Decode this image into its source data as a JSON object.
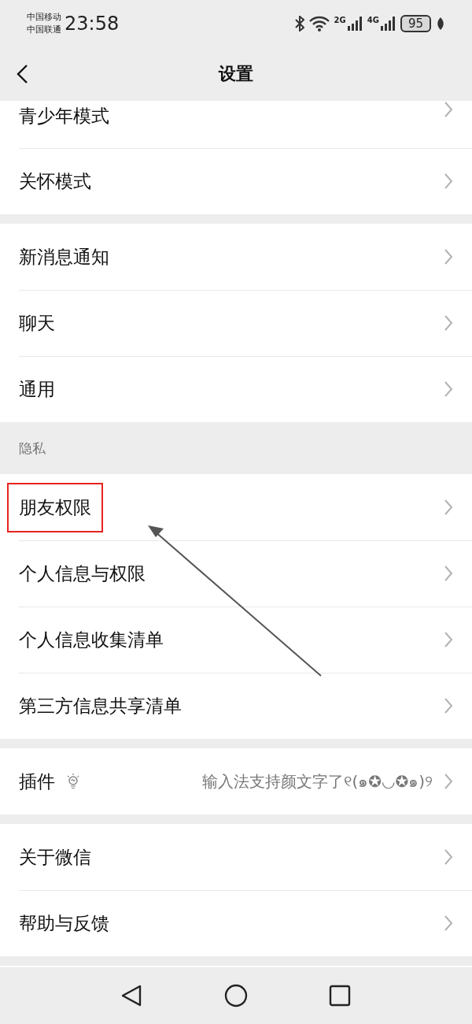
{
  "status_bar": {
    "carriers": [
      "中国移动",
      "中国联通"
    ],
    "time": "23:58",
    "networks": [
      "2G",
      "4G"
    ],
    "battery": "95"
  },
  "nav": {
    "title": "设置"
  },
  "groups": [
    {
      "items": [
        {
          "kind": "link",
          "label": "青少年模式",
          "annotated": false,
          "cut": true
        },
        {
          "kind": "link",
          "label": "关怀模式",
          "annotated": false
        }
      ]
    },
    {
      "items": [
        {
          "kind": "link",
          "label": "新消息通知",
          "annotated": false
        },
        {
          "kind": "link",
          "label": "聊天",
          "annotated": false
        },
        {
          "kind": "link",
          "label": "通用",
          "annotated": false
        }
      ]
    },
    {
      "header": "隐私",
      "items": [
        {
          "kind": "link",
          "label": "朋友权限",
          "annotated": true
        },
        {
          "kind": "link",
          "label": "个人信息与权限",
          "annotated": false
        },
        {
          "kind": "link",
          "label": "个人信息收集清单",
          "annotated": false
        },
        {
          "kind": "link",
          "label": "第三方信息共享清单",
          "annotated": false
        }
      ]
    },
    {
      "items": [
        {
          "kind": "plugin",
          "label": "插件",
          "value": "输入法支持颜文字了୧(๑✪◡✪๑)୨",
          "annotated": false
        }
      ]
    },
    {
      "items": [
        {
          "kind": "link",
          "label": "关于微信",
          "annotated": false
        },
        {
          "kind": "link",
          "label": "帮助与反馈",
          "annotated": false
        }
      ]
    }
  ]
}
